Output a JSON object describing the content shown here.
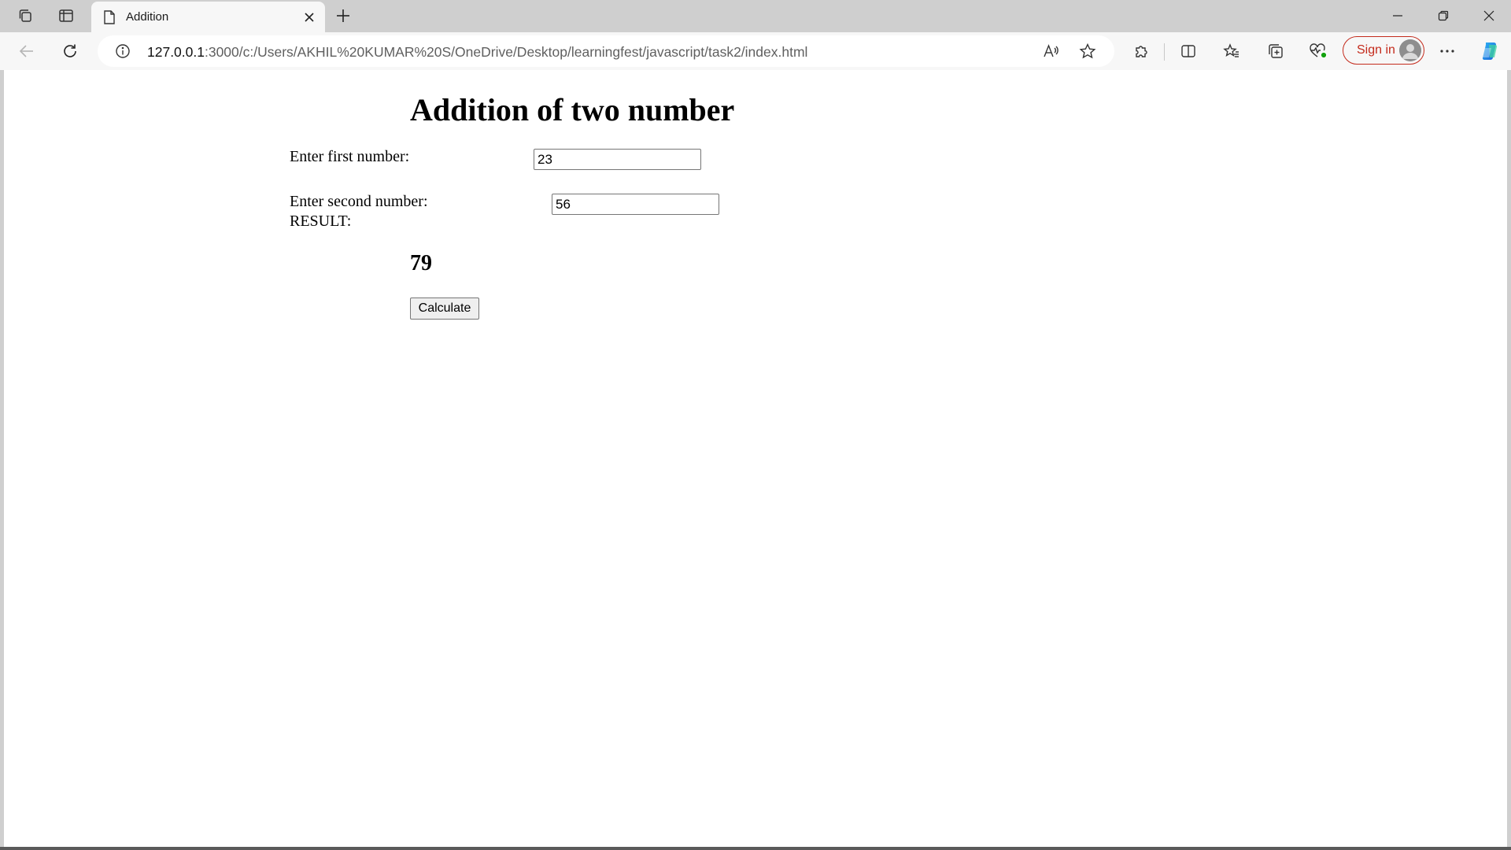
{
  "browser": {
    "tab": {
      "title": "Addition",
      "close_label": "×"
    },
    "address": {
      "host": "127.0.0.1",
      "path": ":3000/c:/Users/AKHIL%20KUMAR%20S/OneDrive/Desktop/learningfest/javascript/task2/index.html"
    },
    "signin_label": "Sign in",
    "icons": {
      "workspaces": "workspaces-icon",
      "tab_actions": "tab-actions-icon",
      "page": "page-icon",
      "new_tab": "plus-icon",
      "back": "back-arrow-icon",
      "refresh": "refresh-icon",
      "info": "info-icon",
      "read_aloud": "read-aloud-icon",
      "favorite": "star-icon",
      "extensions": "puzzle-icon",
      "split_screen": "split-screen-icon",
      "favorites": "favorites-icon",
      "collections": "collections-icon",
      "browser_essentials": "heart-pulse-icon",
      "more": "ellipsis-icon",
      "copilot": "copilot-icon"
    },
    "colors": {
      "signin_accent": "#c42b1c",
      "copilot": "#1f8ef1"
    }
  },
  "page": {
    "title": "Addition of two number",
    "first_label": "Enter first number:",
    "first_value": "23",
    "second_label": "Enter second number:",
    "second_value": "56",
    "result_label": "RESULT:",
    "result_value": "79",
    "button_label": "Calculate"
  }
}
